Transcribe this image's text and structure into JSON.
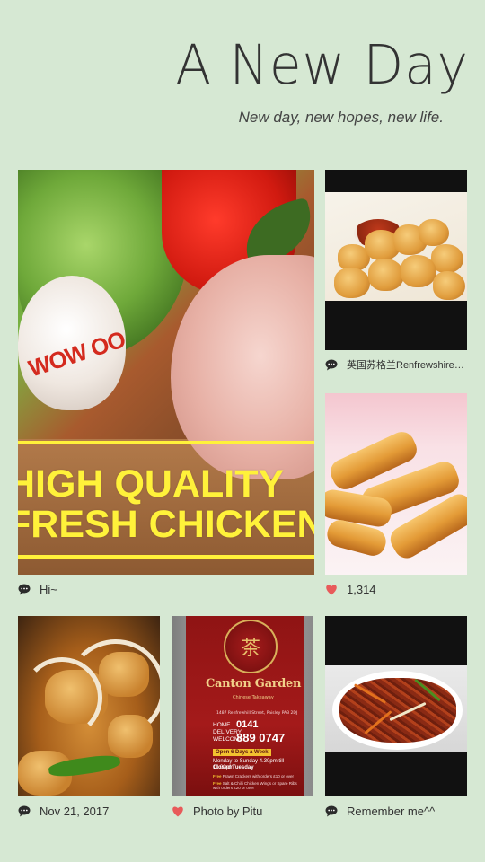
{
  "header": {
    "title": "A New Day",
    "subtitle": "New day, new hopes, new life."
  },
  "tiles": [
    {
      "image": "high-quality-fresh-chicken-ad",
      "ad_brand": "WOW OO",
      "ad_line1": "HIGH QUALITY",
      "ad_line2": "FRESH CHICKEN",
      "caption_icon": "comment-icon",
      "caption": "Hi~"
    },
    {
      "image": "popcorn-chicken-photo",
      "caption_icon": "comment-icon",
      "caption": "英国苏格兰RenfrewshireGreenl…"
    },
    {
      "image": "spring-rolls-photo",
      "caption_icon": "heart-icon",
      "caption": "1,314"
    },
    {
      "image": "chicken-with-peppers-photo",
      "caption_icon": "comment-icon",
      "caption": "Nov 21, 2017"
    },
    {
      "image": "canton-garden-menu-card",
      "menu": {
        "brand": "Canton Garden",
        "cuisine": "Chinese Takeaway",
        "address": "1487 Renfrewhill Street, Paisley PA3 2DJ",
        "home_label": "HOME DELIVERY WELCOME",
        "phone_line1": "0141",
        "phone_line2": "889 0747",
        "open_label": "Open 6 Days a Week",
        "hours": "Monday to Sunday 4.30pm till 11.00pm",
        "closed": "Closed Tuesday",
        "free1_label": "Free",
        "free1": "Prawn Crackers with orders £10 or over",
        "free2_label": "Free",
        "free2": "Salt & Chilli Chicken Wings or Spare Ribs with orders £20 or over"
      },
      "caption_icon": "heart-icon",
      "caption": "Photo by Pitu"
    },
    {
      "image": "shredded-chilli-beef-photo",
      "caption_icon": "comment-icon",
      "caption": "Remember me^^"
    }
  ],
  "colors": {
    "background": "#d6e8d3",
    "heart": "#e85a5a",
    "ad_text": "#fff23a"
  }
}
